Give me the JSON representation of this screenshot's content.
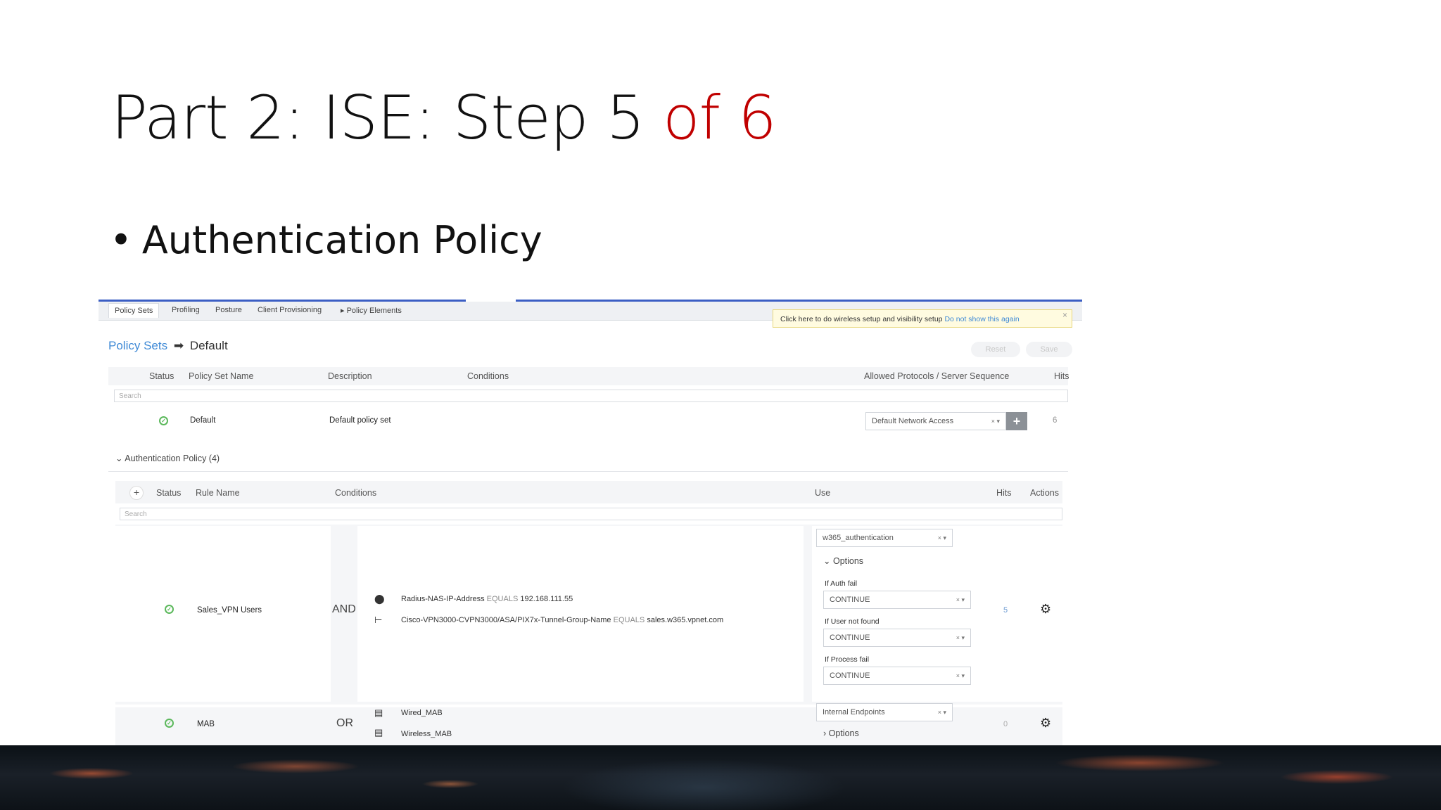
{
  "slide": {
    "title_main": "Part 2: ISE: Step 5 ",
    "title_accent": "of 6",
    "bullet": "Authentication Policy",
    "accent_color": "#c00000"
  },
  "nav": {
    "tabs": [
      "Policy Sets",
      "Profiling",
      "Posture",
      "Client Provisioning",
      "Policy Elements"
    ],
    "policy_elements_arrow": "▸"
  },
  "banner": {
    "text": "Click here to do wireless setup and visibility setup",
    "link": "Do not show this again",
    "close": "×"
  },
  "breadcrumb": {
    "link": "Policy Sets",
    "arrow": "➡",
    "current": "Default"
  },
  "buttons": {
    "reset": "Reset",
    "save": "Save"
  },
  "policy_sets_table": {
    "headers": {
      "status": "Status",
      "name": "Policy Set Name",
      "description": "Description",
      "conditions": "Conditions",
      "allowed": "Allowed Protocols / Server Sequence",
      "hits": "Hits"
    },
    "search_placeholder": "Search",
    "row": {
      "name": "Default",
      "description": "Default policy set",
      "allowed": "Default Network Access",
      "hits": "6"
    }
  },
  "auth_policy": {
    "section_label": "Authentication Policy (4)",
    "headers": {
      "status": "Status",
      "rule_name": "Rule Name",
      "conditions": "Conditions",
      "use": "Use",
      "hits": "Hits",
      "actions": "Actions"
    },
    "search_placeholder": "Search",
    "rules": [
      {
        "name": "Sales_VPN Users",
        "operator": "AND",
        "conditions": [
          {
            "attr": "Radius-NAS-IP-Address",
            "op": "EQUALS",
            "value": "192.168.111.55"
          },
          {
            "attr": "Cisco-VPN3000-CVPN3000/ASA/PIX7x-Tunnel-Group-Name",
            "op": "EQUALS",
            "value": "sales.w365.vpnet.com"
          }
        ],
        "use": "w365_authentication",
        "options_label": "Options",
        "if_auth_fail": "If Auth fail",
        "if_auth_fail_value": "CONTINUE",
        "if_user_not_found": "If User not found",
        "if_user_not_found_value": "CONTINUE",
        "if_process_fail": "If Process fail",
        "if_process_fail_value": "CONTINUE",
        "hits": "5"
      },
      {
        "name": "MAB",
        "operator": "OR",
        "conditions": [
          {
            "attr": "Wired_MAB"
          },
          {
            "attr": "Wireless_MAB"
          }
        ],
        "use": "Internal Endpoints",
        "options_label": "Options",
        "hits": "0"
      }
    ]
  }
}
